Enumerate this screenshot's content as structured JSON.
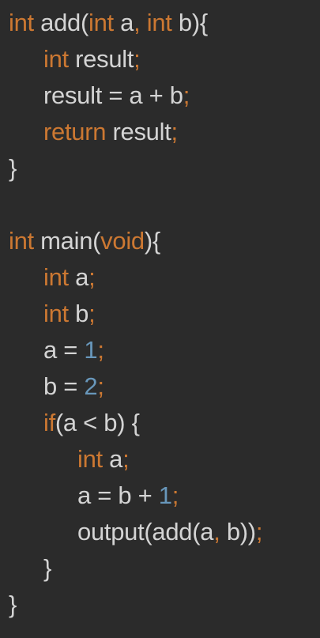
{
  "colors": {
    "background": "#2b2b2b",
    "keyword": "#cc7832",
    "identifier": "#d4d4d4",
    "punctuation": "#cc7832",
    "number": "#6897bb"
  },
  "code": {
    "lines": [
      {
        "indent": 0,
        "tokens": [
          {
            "t": "int",
            "k": "keyword"
          },
          {
            "t": " add(",
            "k": "identifier"
          },
          {
            "t": "int",
            "k": "keyword"
          },
          {
            "t": " a",
            "k": "identifier"
          },
          {
            "t": ", ",
            "k": "punctuation"
          },
          {
            "t": "int",
            "k": "keyword"
          },
          {
            "t": " b",
            "k": "identifier"
          },
          {
            "t": "){",
            "k": "identifier"
          }
        ]
      },
      {
        "indent": 1,
        "tokens": [
          {
            "t": "int",
            "k": "keyword"
          },
          {
            "t": " result",
            "k": "identifier"
          },
          {
            "t": ";",
            "k": "punctuation"
          }
        ]
      },
      {
        "indent": 1,
        "tokens": [
          {
            "t": "result = a + b",
            "k": "identifier"
          },
          {
            "t": ";",
            "k": "punctuation"
          }
        ]
      },
      {
        "indent": 1,
        "tokens": [
          {
            "t": "return",
            "k": "keyword"
          },
          {
            "t": " result",
            "k": "identifier"
          },
          {
            "t": ";",
            "k": "punctuation"
          }
        ]
      },
      {
        "indent": 0,
        "tokens": [
          {
            "t": "}",
            "k": "identifier"
          }
        ]
      },
      {
        "indent": 0,
        "tokens": []
      },
      {
        "indent": 0,
        "tokens": [
          {
            "t": "int",
            "k": "keyword"
          },
          {
            "t": " main(",
            "k": "identifier"
          },
          {
            "t": "void",
            "k": "keyword"
          },
          {
            "t": "){",
            "k": "identifier"
          }
        ]
      },
      {
        "indent": 1,
        "tokens": [
          {
            "t": "int",
            "k": "keyword"
          },
          {
            "t": " a",
            "k": "identifier"
          },
          {
            "t": ";",
            "k": "punctuation"
          }
        ]
      },
      {
        "indent": 1,
        "tokens": [
          {
            "t": "int",
            "k": "keyword"
          },
          {
            "t": " b",
            "k": "identifier"
          },
          {
            "t": ";",
            "k": "punctuation"
          }
        ]
      },
      {
        "indent": 1,
        "tokens": [
          {
            "t": "a = ",
            "k": "identifier"
          },
          {
            "t": "1",
            "k": "number"
          },
          {
            "t": ";",
            "k": "punctuation"
          }
        ]
      },
      {
        "indent": 1,
        "tokens": [
          {
            "t": "b = ",
            "k": "identifier"
          },
          {
            "t": "2",
            "k": "number"
          },
          {
            "t": ";",
            "k": "punctuation"
          }
        ]
      },
      {
        "indent": 1,
        "tokens": [
          {
            "t": "if",
            "k": "keyword"
          },
          {
            "t": "(a < b) {",
            "k": "identifier"
          }
        ]
      },
      {
        "indent": 2,
        "tokens": [
          {
            "t": "int",
            "k": "keyword"
          },
          {
            "t": " a",
            "k": "identifier"
          },
          {
            "t": ";",
            "k": "punctuation"
          }
        ]
      },
      {
        "indent": 2,
        "tokens": [
          {
            "t": "a = b + ",
            "k": "identifier"
          },
          {
            "t": "1",
            "k": "number"
          },
          {
            "t": ";",
            "k": "punctuation"
          }
        ]
      },
      {
        "indent": 2,
        "tokens": [
          {
            "t": "output(add(a",
            "k": "identifier"
          },
          {
            "t": ", ",
            "k": "punctuation"
          },
          {
            "t": "b))",
            "k": "identifier"
          },
          {
            "t": ";",
            "k": "punctuation"
          }
        ]
      },
      {
        "indent": 1,
        "tokens": [
          {
            "t": "}",
            "k": "identifier"
          }
        ]
      },
      {
        "indent": 0,
        "tokens": [
          {
            "t": "}",
            "k": "identifier"
          }
        ]
      }
    ]
  }
}
